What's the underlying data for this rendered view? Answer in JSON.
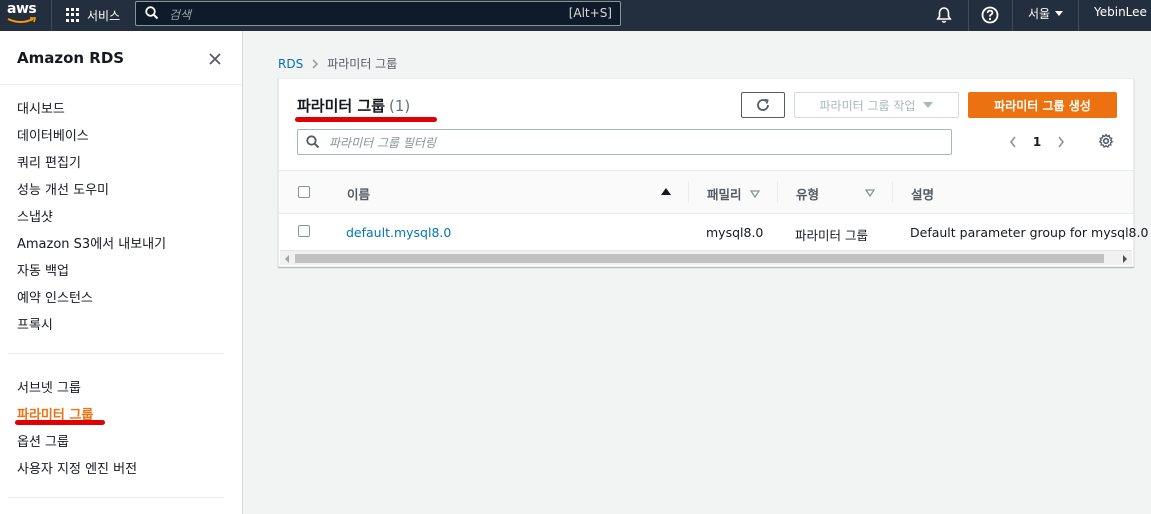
{
  "topnav": {
    "logo_text": "aws",
    "services_label": "서비스",
    "search_placeholder": "검색",
    "search_shortcut": "[Alt+S]",
    "region_label": "서울",
    "user_label": "YebinLee"
  },
  "sidebar": {
    "title": "Amazon RDS",
    "items": [
      {
        "label": "대시보드"
      },
      {
        "label": "데이터베이스"
      },
      {
        "label": "쿼리 편집기"
      },
      {
        "label": "성능 개선 도우미"
      },
      {
        "label": "스냅샷"
      },
      {
        "label": "Amazon S3에서 내보내기"
      },
      {
        "label": "자동 백업"
      },
      {
        "label": "예약 인스턴스"
      },
      {
        "label": "프록시"
      },
      {
        "label": "서브넷 그룹"
      },
      {
        "label": "파라미터 그룹",
        "active": true
      },
      {
        "label": "옵션 그룹"
      },
      {
        "label": "사용자 지정 엔진 버전"
      }
    ]
  },
  "breadcrumb": {
    "root": "RDS",
    "current": "파라미터 그룹"
  },
  "panel": {
    "title": "파라미터 그룹",
    "count": "(1)",
    "actions_label": "파라미터 그룹 작업",
    "create_label": "파라미터 그룹 생성",
    "filter_placeholder": "파라미터 그룹 필터링",
    "page_number": "1"
  },
  "table": {
    "columns": [
      "이름",
      "패밀리",
      "유형",
      "설명"
    ],
    "rows": [
      {
        "name": "default.mysql8.0",
        "family": "mysql8.0",
        "type": "파라미터 그룹",
        "description": "Default parameter group for mysql8.0"
      }
    ]
  },
  "colors": {
    "nav_bg": "#232f3e",
    "accent": "#ec7211",
    "link": "#0073bb",
    "annotation": "#e00000"
  }
}
